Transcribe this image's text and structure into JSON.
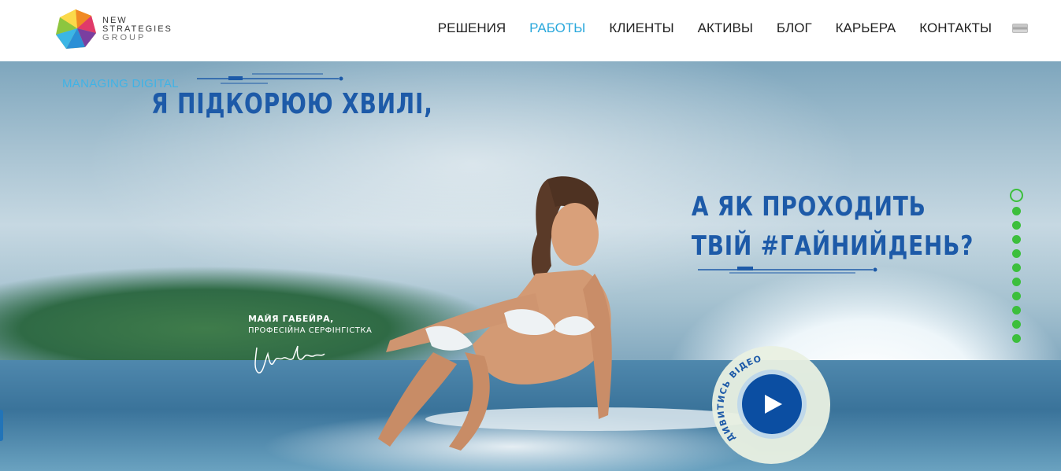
{
  "brand": {
    "line1": "NEW",
    "line2": "STRATEGIES",
    "line3": "GROUP",
    "logo_icon": "polyhedron-logo-icon"
  },
  "nav": {
    "items": [
      {
        "label": "РЕШЕНИЯ",
        "active": false
      },
      {
        "label": "РАБОТЫ",
        "active": true
      },
      {
        "label": "КЛИЕНТЫ",
        "active": false
      },
      {
        "label": "АКТИВЫ",
        "active": false
      },
      {
        "label": "БЛОГ",
        "active": false
      },
      {
        "label": "КАРЬЕРА",
        "active": false
      },
      {
        "label": "КОНТАКТЫ",
        "active": false
      }
    ],
    "language_icon": "flag-icon",
    "active_color": "#2aa8dc"
  },
  "hero": {
    "eyebrow": "MANAGING DIGITAL",
    "headline1": "Я ПІДКОРЮЮ ХВИЛІ,",
    "headline2_line1": "А ЯК ПРОХОДИТЬ",
    "headline2_line2": "ТВІЙ #ГАЙНИЙДЕНЬ?",
    "caption_name": "МАЙЯ ГАБЕЙРА,",
    "caption_role": "ПРОФЕСІЙНА СЕРФІНГІСТКА",
    "video_label": "ДИВИТИСЬ ВІДЕО",
    "headline_color": "#1d5aa8",
    "play_color": "#0b4ea2"
  },
  "pager": {
    "count": 11,
    "active_index": 0,
    "color": "#3cbf3c"
  }
}
